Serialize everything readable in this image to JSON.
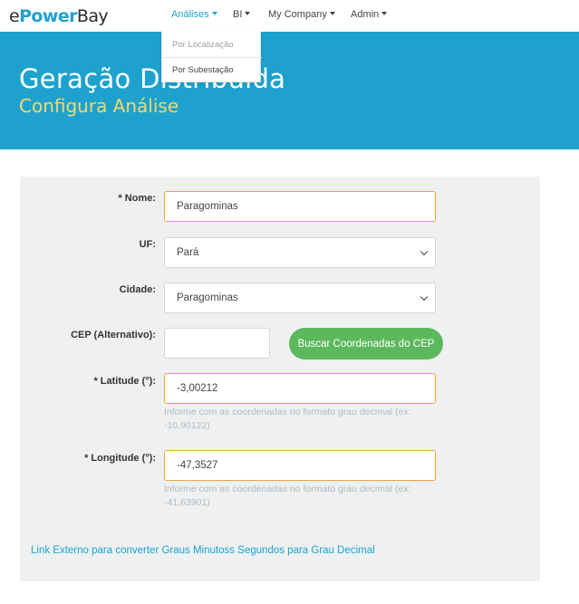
{
  "nav": {
    "logo_prefix": "e",
    "logo_mid": "Power",
    "logo_suffix": "Bay",
    "items": [
      {
        "label": "Análises"
      },
      {
        "label": "BI"
      },
      {
        "label": "My Company"
      },
      {
        "label": "Admin"
      }
    ]
  },
  "dropdown": {
    "items": [
      {
        "label": "Por Localização"
      },
      {
        "label": "Por Subestação"
      }
    ]
  },
  "banner": {
    "title": "Geração Distribuída",
    "subtitle": "Configura Análise"
  },
  "form": {
    "nome": {
      "label": "* Nome:",
      "value": "Paragominas"
    },
    "uf": {
      "label": "UF:",
      "value": "Pará"
    },
    "cidade": {
      "label": "Cidade:",
      "value": "Paragominas"
    },
    "cep": {
      "label": "CEP (Alternativo):",
      "value": "",
      "button": "Buscar Coordenadas do CEP"
    },
    "latitude": {
      "label": "* Latitude (°):",
      "value": "-3,00212",
      "help": "Informe com as coordenadas no formato grau decimal (ex: -10,90122)"
    },
    "longitude": {
      "label": "* Longitude (°):",
      "value": "-47,3527",
      "help": "Informe com as coordenadas no formato grau decimal (ex: -41,63901)"
    },
    "link": "Link Externo para converter Graus Minutoss Segundos para Grau Decimal"
  },
  "colors": {
    "brand": "#1ea2cd",
    "accent_subtitle": "#f5d76e",
    "focus_border": "#f0a43c",
    "button_green": "#5cb85c"
  }
}
